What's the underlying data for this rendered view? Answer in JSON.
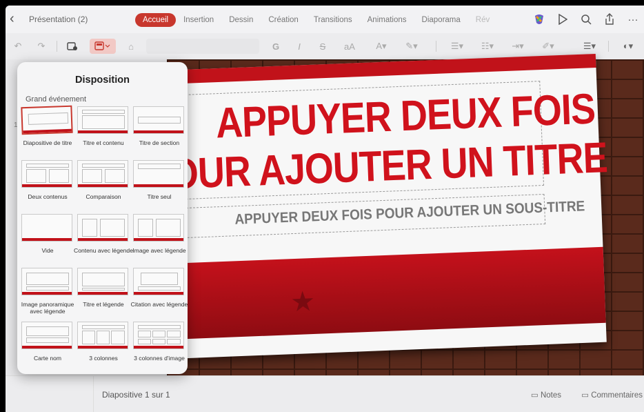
{
  "header": {
    "document_title": "Présentation (2)",
    "tabs": [
      {
        "label": "Accueil",
        "active": true
      },
      {
        "label": "Insertion",
        "active": false
      },
      {
        "label": "Dessin",
        "active": false
      },
      {
        "label": "Création",
        "active": false
      },
      {
        "label": "Transitions",
        "active": false
      },
      {
        "label": "Animations",
        "active": false
      },
      {
        "label": "Diaporama",
        "active": false
      },
      {
        "label": "Rév",
        "active": false
      }
    ],
    "icons": [
      "copilot-icon",
      "play-icon",
      "search-icon",
      "share-icon",
      "more-icon"
    ]
  },
  "toolbar": {
    "icons": [
      "undo-icon",
      "redo-icon",
      "new-slide-icon",
      "layout-icon",
      "format-painter-icon",
      "bold-icon",
      "italic-icon",
      "strikethrough-icon",
      "font-size-icon",
      "font-color-icon",
      "highlight-icon",
      "bullets-icon",
      "numbering-icon",
      "indent-icon",
      "styles-icon",
      "align-icon",
      "shapes-icon"
    ],
    "bold_glyph": "G",
    "italic_glyph": "I",
    "strike_glyph": "S",
    "fontsize_glyph": "aA"
  },
  "slide": {
    "number": "1",
    "title": "APPUYER DEUX FOIS\nOUR AJOUTER UN TITRE",
    "subtitle": "APPUYER DEUX FOIS POUR AJOUTER UN SOUS-TITRE",
    "accent_color": "#c1121a"
  },
  "layout_panel": {
    "title": "Disposition",
    "section": "Grand événement",
    "layouts": [
      {
        "label": "Diapositive de titre",
        "selected": true
      },
      {
        "label": "Titre et contenu",
        "selected": false
      },
      {
        "label": "Titre de section",
        "selected": false
      },
      {
        "label": "Deux contenus",
        "selected": false
      },
      {
        "label": "Comparaison",
        "selected": false
      },
      {
        "label": "Titre seul",
        "selected": false
      },
      {
        "label": "Vide",
        "selected": false
      },
      {
        "label": "Contenu avec légende",
        "selected": false
      },
      {
        "label": "Image avec légende",
        "selected": false
      },
      {
        "label": "Image panoramique avec légende",
        "selected": false
      },
      {
        "label": "Titre et légende",
        "selected": false
      },
      {
        "label": "Citation avec légende",
        "selected": false
      },
      {
        "label": "Carte nom",
        "selected": false
      },
      {
        "label": "3 colonnes",
        "selected": false
      },
      {
        "label": "3 colonnes d'image",
        "selected": false
      }
    ]
  },
  "status_bar": {
    "slide_counter": "Diapositive 1 sur 1",
    "notes_label": "Notes",
    "comments_label": "Commentaires"
  }
}
